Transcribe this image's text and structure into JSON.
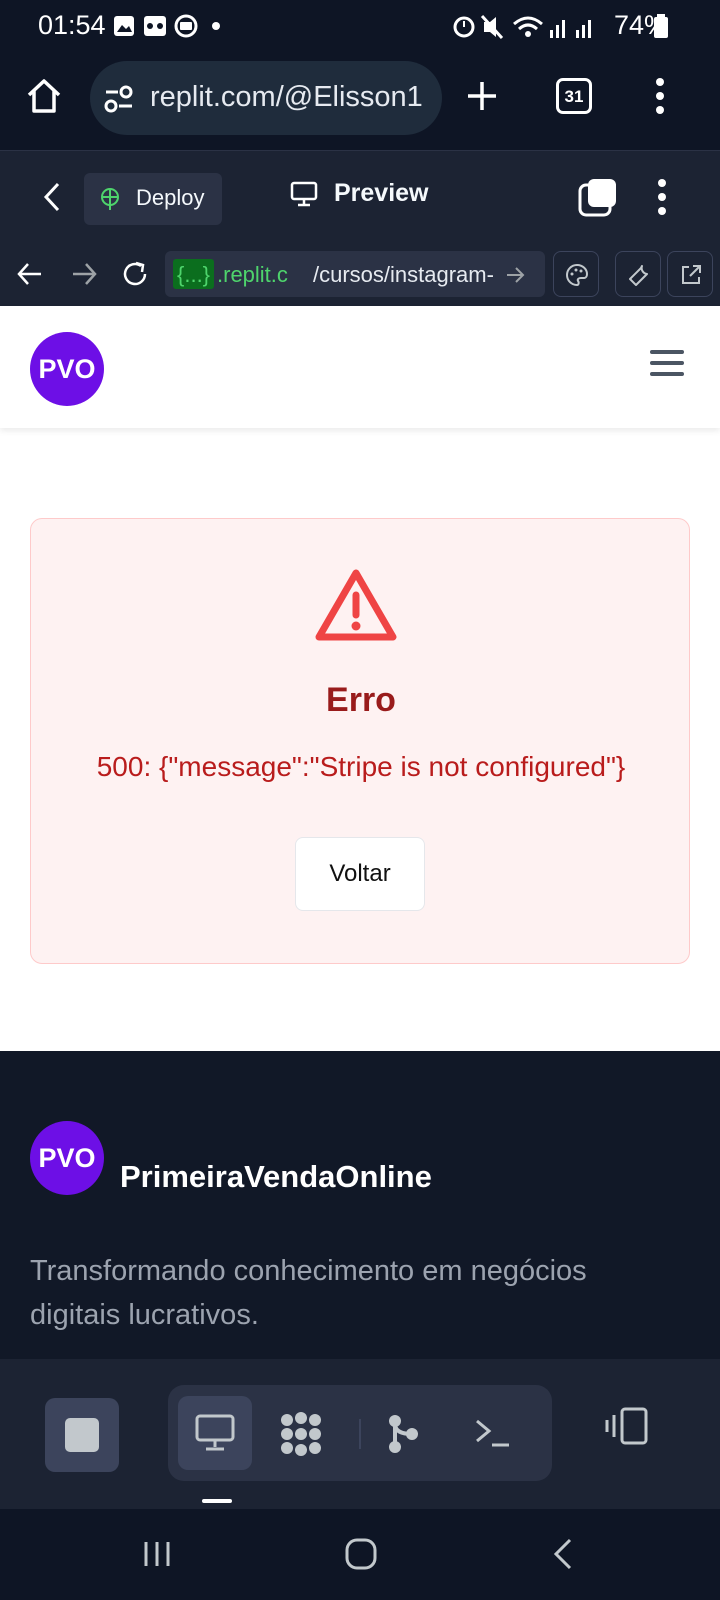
{
  "status_bar": {
    "time": "01:54",
    "battery": "74%"
  },
  "browser": {
    "url": "replit.com/@Elisson1",
    "tab_count": "31"
  },
  "replit_toolbar": {
    "deploy_label": "Deploy",
    "preview_label": "Preview"
  },
  "preview_nav": {
    "address_tag": "{...}",
    "address_host": ".replit.c",
    "address_path": "/cursos/instagram-"
  },
  "site": {
    "logo_text": "PVO",
    "error": {
      "title": "Erro",
      "message": "500: {\"message\":\"Stripe is not configured\"}",
      "back_button": "Voltar"
    },
    "footer": {
      "logo_text": "PVO",
      "brand": "PrimeiraVendaOnline",
      "tagline": "Transformando conhecimento em negócios digitais lucrativos."
    }
  },
  "colors": {
    "brand_purple": "#6d0fe6",
    "error_red": "#b91c1c",
    "error_bg": "#fef2f2",
    "footer_bg": "#111827"
  }
}
